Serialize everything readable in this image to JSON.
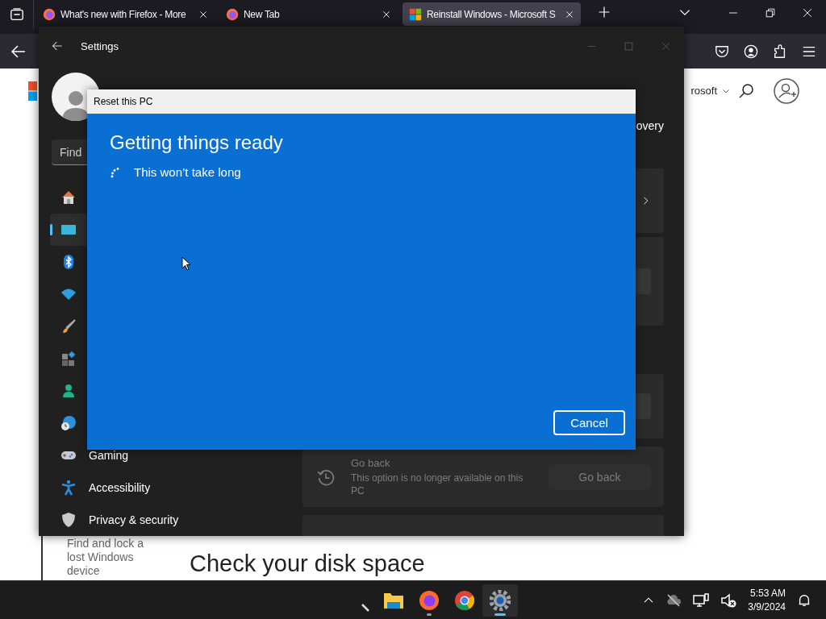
{
  "browser": {
    "tabs": [
      {
        "title": "What's new with Firefox - More",
        "kind": "firefox",
        "selected": false
      },
      {
        "title": "New Tab",
        "kind": "firefox",
        "selected": false
      },
      {
        "title": "Reinstall Windows - Microsoft S",
        "kind": "microsoft",
        "selected": true
      }
    ],
    "page": {
      "menu_label": "rosoft",
      "side_text": "Find and lock a lost Windows device",
      "heading": "Check your disk space"
    }
  },
  "settings": {
    "title": "Settings",
    "search": {
      "placeholder": "Find"
    },
    "subtitle": "overy",
    "nav": [
      {
        "kind": "home",
        "selected": false
      },
      {
        "kind": "system",
        "selected": true
      },
      {
        "kind": "bluetooth",
        "selected": false
      },
      {
        "kind": "wifi",
        "selected": false
      },
      {
        "kind": "brush",
        "selected": false
      },
      {
        "kind": "apps",
        "selected": false
      },
      {
        "kind": "accounts",
        "selected": false
      },
      {
        "kind": "time",
        "selected": false
      },
      {
        "kind": "gaming",
        "label": "Gaming",
        "selected": false
      },
      {
        "kind": "accessibility",
        "label": "Accessibility",
        "selected": false
      },
      {
        "kind": "privacy",
        "label": "Privacy & security",
        "selected": false
      }
    ],
    "go_back": {
      "title": "Go back",
      "description": "This option is no longer available on this PC",
      "button": "Go back",
      "disabled": true
    }
  },
  "dialog": {
    "title": "Reset this PC",
    "heading": "Getting things ready",
    "status": "This won’t take long",
    "button": "Cancel"
  },
  "taskbar": {
    "apps": [
      {
        "kind": "pen",
        "running": false,
        "active": false
      },
      {
        "kind": "folder",
        "running": false,
        "active": false
      },
      {
        "kind": "firefox",
        "running": true,
        "active": false
      },
      {
        "kind": "chrome",
        "running": false,
        "active": false
      },
      {
        "kind": "settings",
        "running": true,
        "active": true
      }
    ],
    "time": "5:53 AM",
    "date": "3/9/2024"
  }
}
